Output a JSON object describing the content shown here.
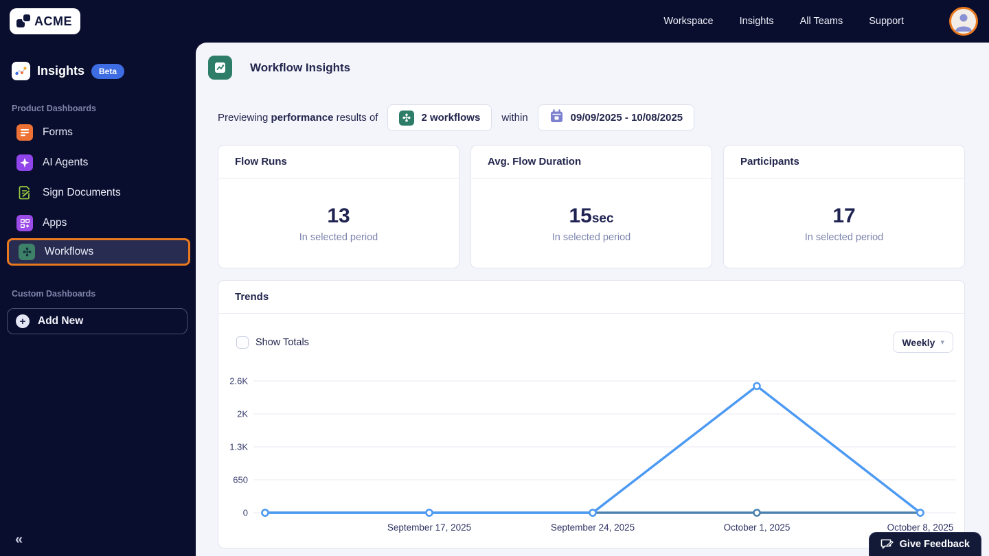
{
  "topbar": {
    "logo_text": "ACME",
    "nav": [
      {
        "label": "Workspace"
      },
      {
        "label": "Insights"
      },
      {
        "label": "All Teams"
      },
      {
        "label": "Support"
      }
    ]
  },
  "sidebar": {
    "header": {
      "title": "Insights",
      "badge": "Beta"
    },
    "sections": [
      {
        "label": "Product Dashboards",
        "items": [
          {
            "label": "Forms",
            "icon": "forms-icon",
            "color": "#ED7135"
          },
          {
            "label": "AI Agents",
            "icon": "ai-agents-icon",
            "color": "#8F45E9"
          },
          {
            "label": "Sign Documents",
            "icon": "sign-documents-icon",
            "color": "#93C83E"
          },
          {
            "label": "Apps",
            "icon": "apps-icon",
            "color": "#9A4BE8"
          },
          {
            "label": "Workflows",
            "icon": "workflows-icon",
            "color": "#3E8169",
            "selected": true
          }
        ]
      },
      {
        "label": "Custom Dashboards",
        "items": []
      }
    ],
    "add_new_label": "Add New",
    "collapse_icon": "«"
  },
  "main": {
    "page_title": "Workflow Insights",
    "preview": {
      "prefix": "Previewing",
      "emphasis": "performance",
      "suffix": "results of",
      "workflows_chip": "2 workflows",
      "within_label": "within",
      "date_chip": "09/09/2025 - 10/08/2025"
    },
    "stats": [
      {
        "title": "Flow Runs",
        "value": "13",
        "unit": "",
        "caption": "In selected period"
      },
      {
        "title": "Avg. Flow Duration",
        "value": "15",
        "unit": "sec",
        "caption": "In selected period"
      },
      {
        "title": "Participants",
        "value": "17",
        "unit": "",
        "caption": "In selected period"
      }
    ],
    "trends": {
      "title": "Trends",
      "show_totals_label": "Show Totals",
      "show_totals_checked": false,
      "interval_label": "Weekly"
    }
  },
  "feedback_button": {
    "label": "Give Feedback"
  },
  "colors": {
    "navy_bg": "#0A0E2E",
    "accent_orange": "#E8791F",
    "beta_blue": "#3D6CE3",
    "panel_bg": "#F4F5FB",
    "header_icon_green": "#2E7D68",
    "calendar_purple": "#7B80CF",
    "chart_line_bright": "#4D9AF3",
    "chart_line_muted": "#4C82AD",
    "grid": "#E9EAF3"
  },
  "chart_data": {
    "type": "line",
    "x_labels": [
      "",
      "September 17, 2025",
      "September 24, 2025",
      "October 1, 2025",
      "October 8, 2025"
    ],
    "series": [
      {
        "name": "line-1",
        "color": "#4C82AD",
        "values": [
          0,
          0,
          0,
          0,
          0
        ]
      },
      {
        "name": "line-2",
        "color": "#4D9AF3",
        "values": [
          0,
          0,
          0,
          2500,
          0
        ]
      }
    ],
    "y_ticks": [
      {
        "value": 0,
        "label": "0"
      },
      {
        "value": 650,
        "label": "650"
      },
      {
        "value": 1300,
        "label": "1.3K"
      },
      {
        "value": 1950,
        "label": "2K"
      },
      {
        "value": 2600,
        "label": "2.6K"
      }
    ],
    "ylim": [
      0,
      2600
    ],
    "grid": true,
    "legend": false
  }
}
